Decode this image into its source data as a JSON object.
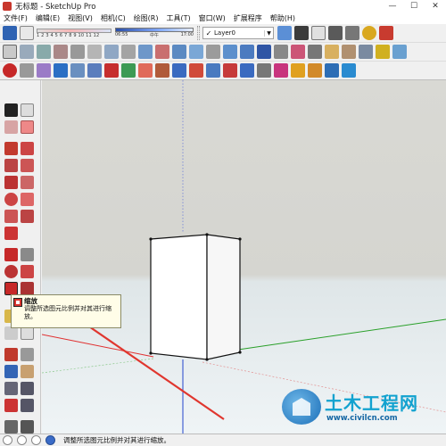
{
  "window": {
    "title": "无标题 - SketchUp Pro",
    "minimize": "—",
    "maximize": "☐",
    "close": "✕"
  },
  "menu": [
    "文件(F)",
    "编辑(E)",
    "视图(V)",
    "相机(C)",
    "绘图(R)",
    "工具(T)",
    "窗口(W)",
    "扩展程序",
    "帮助(H)"
  ],
  "toolbar": {
    "shadow_months": "1 2 3 4 5 6 7 8 9 10 11 12",
    "time_start": "06:55",
    "time_mid": "中午",
    "time_end": "17:00",
    "layer_check": "✓",
    "layer_name": "Layer0",
    "layer_dropdown": "▼"
  },
  "tooltip": {
    "title": "缩放",
    "description": "调整所选图元比例并对其进行缩放。"
  },
  "status": {
    "text": "调整所选图元比例并对其进行缩放。",
    "icon_hint": "?"
  },
  "watermark": {
    "title": "土木工程网",
    "url": "www.civilcn.com"
  },
  "colors": {
    "sky": "#d7d7d2",
    "ground": "#edf3f5",
    "red_axis": "#e03030",
    "green_axis": "#2aa02a",
    "blue_axis": "#2244cc",
    "arrow": "#e0362e",
    "tooltip_bg": "#fffde8"
  }
}
